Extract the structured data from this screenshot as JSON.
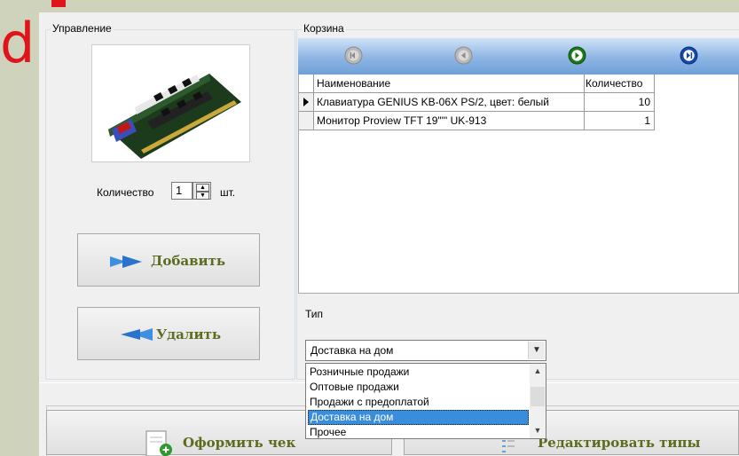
{
  "control": {
    "title": "Управление",
    "quantity_label": "Количество",
    "quantity_value": "1",
    "unit_label": "шт.",
    "add_button": "Добавить",
    "remove_button": "Удалить"
  },
  "cart": {
    "title": "Корзина",
    "nav_buttons": [
      "first-icon",
      "prev-icon",
      "next-icon",
      "last-icon"
    ],
    "columns": [
      "Наименование",
      "Количество"
    ],
    "rows": [
      {
        "name": "Клавиатура GENIUS KB-06X PS/2, цвет: белый",
        "qty": "10"
      },
      {
        "name": "Монитор Proview TFT 19\"\"' UK-913",
        "qty": "1"
      }
    ]
  },
  "type": {
    "label": "Тип",
    "selected": "Доставка на дом",
    "options": [
      "Розничные продажи",
      "Оптовые продажи",
      "Продажи с предоплатой",
      "Доставка на дом",
      "Прочее"
    ]
  },
  "actions": {
    "checkout": "Оформить чек",
    "edit_types": "Редактировать типы"
  },
  "colors": {
    "background": "#cfd3bc",
    "window": "#f0f0f0",
    "accent_red": "#e0141b",
    "button_text": "#5b6b1f",
    "nav_bar": "#8db5e4",
    "selection": "#3a8ddc"
  }
}
